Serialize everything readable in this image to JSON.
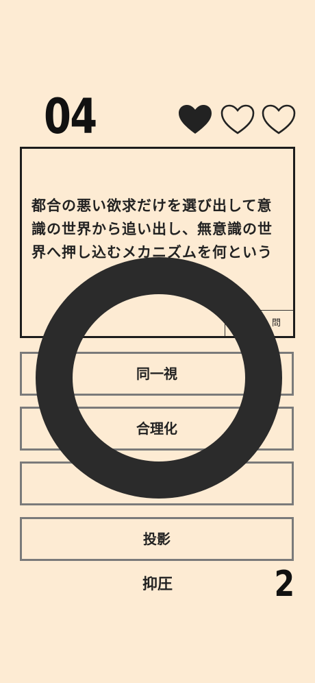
{
  "header": {
    "question_number": "04",
    "lives": [
      {
        "state": "filled",
        "icon": "heart-filled-icon"
      },
      {
        "state": "empty",
        "icon": "heart-outline-icon"
      },
      {
        "state": "empty",
        "icon": "heart-outline-icon"
      }
    ]
  },
  "question": {
    "text": "都合の悪い欲求だけを選び出して意識の世界から追い出し、無意識の世界へ押し込むメカニズムを何という",
    "tag": "問"
  },
  "choices": [
    {
      "label": "同一視"
    },
    {
      "label": "合理化"
    },
    {
      "label": ""
    },
    {
      "label": "投影"
    }
  ],
  "bottom": {
    "label": "抑圧",
    "counter": "2"
  },
  "colors": {
    "background": "#fdebd3",
    "ink": "#222222",
    "ring": "#2b2b2b",
    "choice_border": "#7a7a7a"
  }
}
